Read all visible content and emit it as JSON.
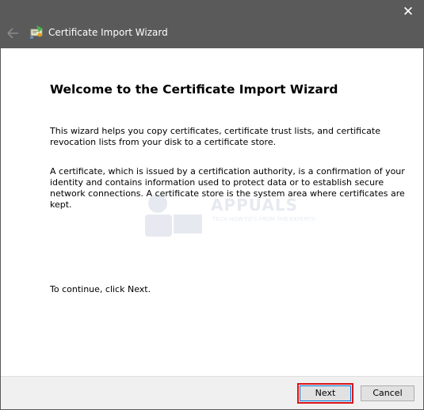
{
  "window": {
    "title": "Certificate Import Wizard",
    "close_glyph": "✕"
  },
  "icons": {
    "back": "back-arrow-icon",
    "app": "certificate-icon",
    "close": "close-icon"
  },
  "content": {
    "heading": "Welcome to the Certificate Import Wizard",
    "paragraph1": "This wizard helps you copy certificates, certificate trust lists, and certificate revocation lists from your disk to a certificate store.",
    "paragraph2": "A certificate, which is issued by a certification authority, is a confirmation of your identity and contains information used to protect data or to establish secure network connections. A certificate store is the system area where certificates are kept.",
    "paragraph3": "To continue, click Next."
  },
  "watermark": {
    "text": "APPUALS",
    "subtext": "TECH HOW-TO'S FROM THE EXPERTS!"
  },
  "footer": {
    "next_label": "Next",
    "cancel_label": "Cancel"
  },
  "colors": {
    "titlebar": "#5a5a5a",
    "highlight": "#d8141a",
    "focus_border": "#0078d7"
  }
}
